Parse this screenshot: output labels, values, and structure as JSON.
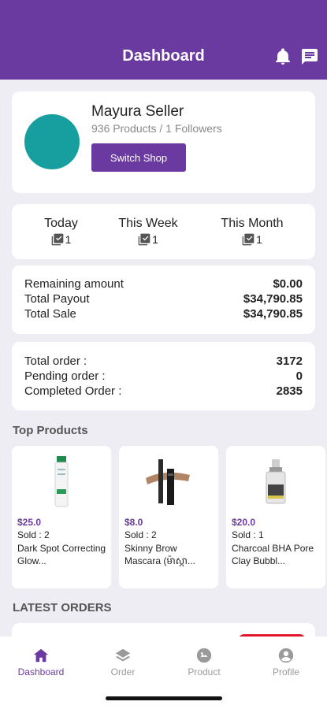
{
  "header": {
    "title": "Dashboard"
  },
  "profile": {
    "name": "Mayura Seller",
    "meta": "936 Products / 1 Followers",
    "switch_label": "Switch Shop"
  },
  "periods": [
    {
      "label": "Today",
      "value": "1"
    },
    {
      "label": "This Week",
      "value": "1"
    },
    {
      "label": "This Month",
      "value": "1"
    }
  ],
  "amounts": [
    {
      "label": "Remaining amount",
      "value": "$0.00"
    },
    {
      "label": "Total Payout",
      "value": "$34,790.85"
    },
    {
      "label": "Total Sale",
      "value": "$34,790.85"
    }
  ],
  "orders": [
    {
      "label": "Total order :",
      "value": "3172"
    },
    {
      "label": "Pending order :",
      "value": "0"
    },
    {
      "label": "Completed Order :",
      "value": "2835"
    }
  ],
  "top_products_title": "Top Products",
  "products": [
    {
      "price": "$25.0",
      "sold": "Sold : 2",
      "name": "Dark Spot Correcting Glow..."
    },
    {
      "price": "$8.0",
      "sold": "Sold : 2",
      "name": "Skinny Brow Mascara (ម៉ាស្កា..."
    },
    {
      "price": "$20.0",
      "sold": "Sold : 1",
      "name": "Charcoal BHA Pore Clay Bubbl..."
    }
  ],
  "latest_orders_title": "LATEST ORDERS",
  "tabs": [
    {
      "label": "Dashboard",
      "icon": "home-icon",
      "active": true
    },
    {
      "label": "Order",
      "icon": "layers-icon",
      "active": false
    },
    {
      "label": "Product",
      "icon": "product-icon",
      "active": false
    },
    {
      "label": "Profile",
      "icon": "user-icon",
      "active": false
    }
  ],
  "colors": {
    "primary": "#6b3aa0",
    "avatar": "#179e9e",
    "background": "#eeedf3",
    "badge": "#e0182a"
  }
}
